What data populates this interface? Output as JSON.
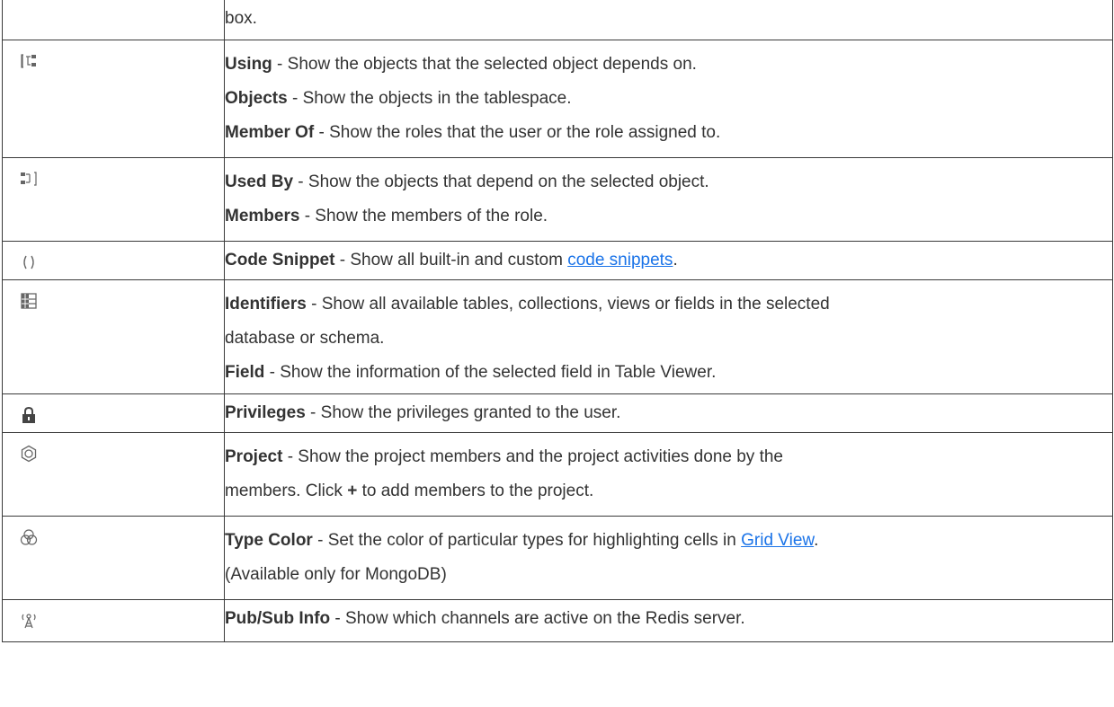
{
  "rows": [
    {
      "icon": "",
      "lines": [
        {
          "text": "box."
        }
      ]
    },
    {
      "icon": "using-dependency-icon",
      "lines": [
        {
          "bold": "Using",
          "text": " - Show the objects that the selected object depends on."
        },
        {
          "bold": "Objects",
          "text": " - Show the objects in the tablespace."
        },
        {
          "bold": "Member Of",
          "text": " - Show the roles that the user or the role assigned to."
        }
      ]
    },
    {
      "icon": "used-by-dependency-icon",
      "lines": [
        {
          "bold": "Used By",
          "text": " - Show the objects that depend on the selected object."
        },
        {
          "bold": "Members",
          "text": " - Show the members of the role."
        }
      ]
    },
    {
      "icon": "parentheses-icon",
      "lines": [
        {
          "bold": "Code Snippet",
          "text": " - Show all built-in and custom ",
          "link": "code snippets",
          "after": "."
        }
      ]
    },
    {
      "icon": "table-grid-icon",
      "lines": [
        {
          "bold": "Identifiers",
          "text": " - Show all available tables, collections, views or fields in the selected"
        },
        {
          "text": "database or schema."
        },
        {
          "bold": "Field",
          "text": " - Show the information of the selected field in Table Viewer."
        }
      ]
    },
    {
      "icon": "lock-icon",
      "lines": [
        {
          "bold": "Privileges",
          "text": " - Show the privileges granted to the user."
        }
      ]
    },
    {
      "icon": "hexagon-project-icon",
      "lines": [
        {
          "bold": "Project",
          "text": " - Show the project members and the project activities done by the"
        },
        {
          "text": "members. Click ",
          "plus": "+",
          "after": " to add members to the project."
        }
      ]
    },
    {
      "icon": "color-circles-icon",
      "lines": [
        {
          "bold": "Type Color",
          "text": " - Set the color of particular types for highlighting cells in ",
          "link": "Grid View",
          "after": "."
        },
        {
          "text": "(Available only for MongoDB)"
        }
      ]
    },
    {
      "icon": "antenna-icon",
      "lines": [
        {
          "bold": "Pub/Sub Info",
          "text": " - Show which channels are active on the Redis server."
        }
      ]
    }
  ],
  "colors": {
    "text": "#333333",
    "link": "#1a73e8",
    "icon": "#666666",
    "border": "#3a3a3a"
  }
}
